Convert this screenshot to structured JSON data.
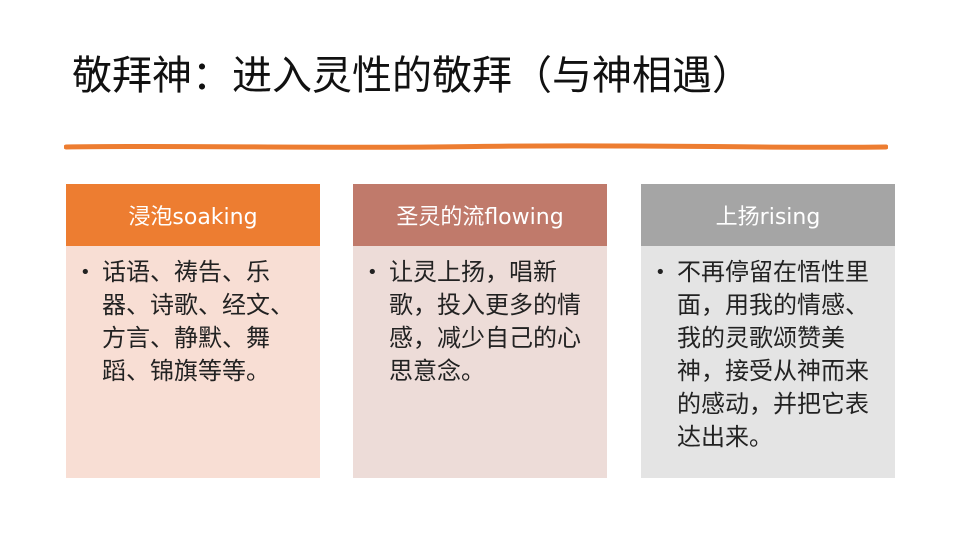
{
  "title": "敬拜神：进入灵性的敬拜（与神相遇）",
  "accent_color": "#ED7D31",
  "cards": [
    {
      "header": "浸泡soaking",
      "header_color": "#ED7D31",
      "body_color": "#F8DED4",
      "bullet": "话语、祷告、乐器、诗歌、经文、方言、静默、舞蹈、锦旗等等。"
    },
    {
      "header": "圣灵的流flowing",
      "header_color": "#C07A6B",
      "body_color": "#EDDCD8",
      "bullet": "让灵上扬，唱新歌，投入更多的情感，减少自己的心思意念。"
    },
    {
      "header": "上扬rising",
      "header_color": "#A5A5A5",
      "body_color": "#E4E4E4",
      "bullet": "不再停留在悟性里面，用我的情感、我的灵歌颂赞美神，接受从神而来的感动，并把它表达出来。"
    }
  ]
}
